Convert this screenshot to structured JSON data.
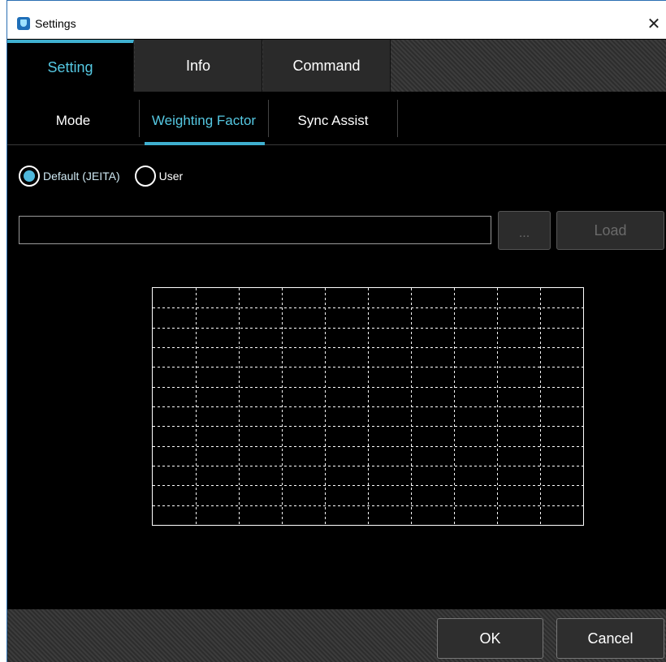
{
  "window": {
    "title": "Settings",
    "close_glyph": "✕"
  },
  "tabs": [
    {
      "label": "Setting",
      "active": true
    },
    {
      "label": "Info",
      "active": false
    },
    {
      "label": "Command",
      "active": false
    }
  ],
  "subtabs": [
    {
      "label": "Mode",
      "active": false
    },
    {
      "label": "Weighting Factor",
      "active": true
    },
    {
      "label": "Sync Assist",
      "active": false
    }
  ],
  "weighting": {
    "options": [
      {
        "label": "Default (JEITA)",
        "checked": true
      },
      {
        "label": "User",
        "checked": false
      }
    ],
    "file_path": "",
    "browse_label": "...",
    "load_label": "Load"
  },
  "grid": {
    "columns": 10,
    "rows": 12
  },
  "footer": {
    "ok_label": "OK",
    "cancel_label": "Cancel"
  },
  "colors": {
    "accent": "#3fb0d0",
    "background": "#000000",
    "radio_fill": "#4fb8dc"
  },
  "icons": {
    "app": "app-shield-icon",
    "close": "close-icon"
  }
}
